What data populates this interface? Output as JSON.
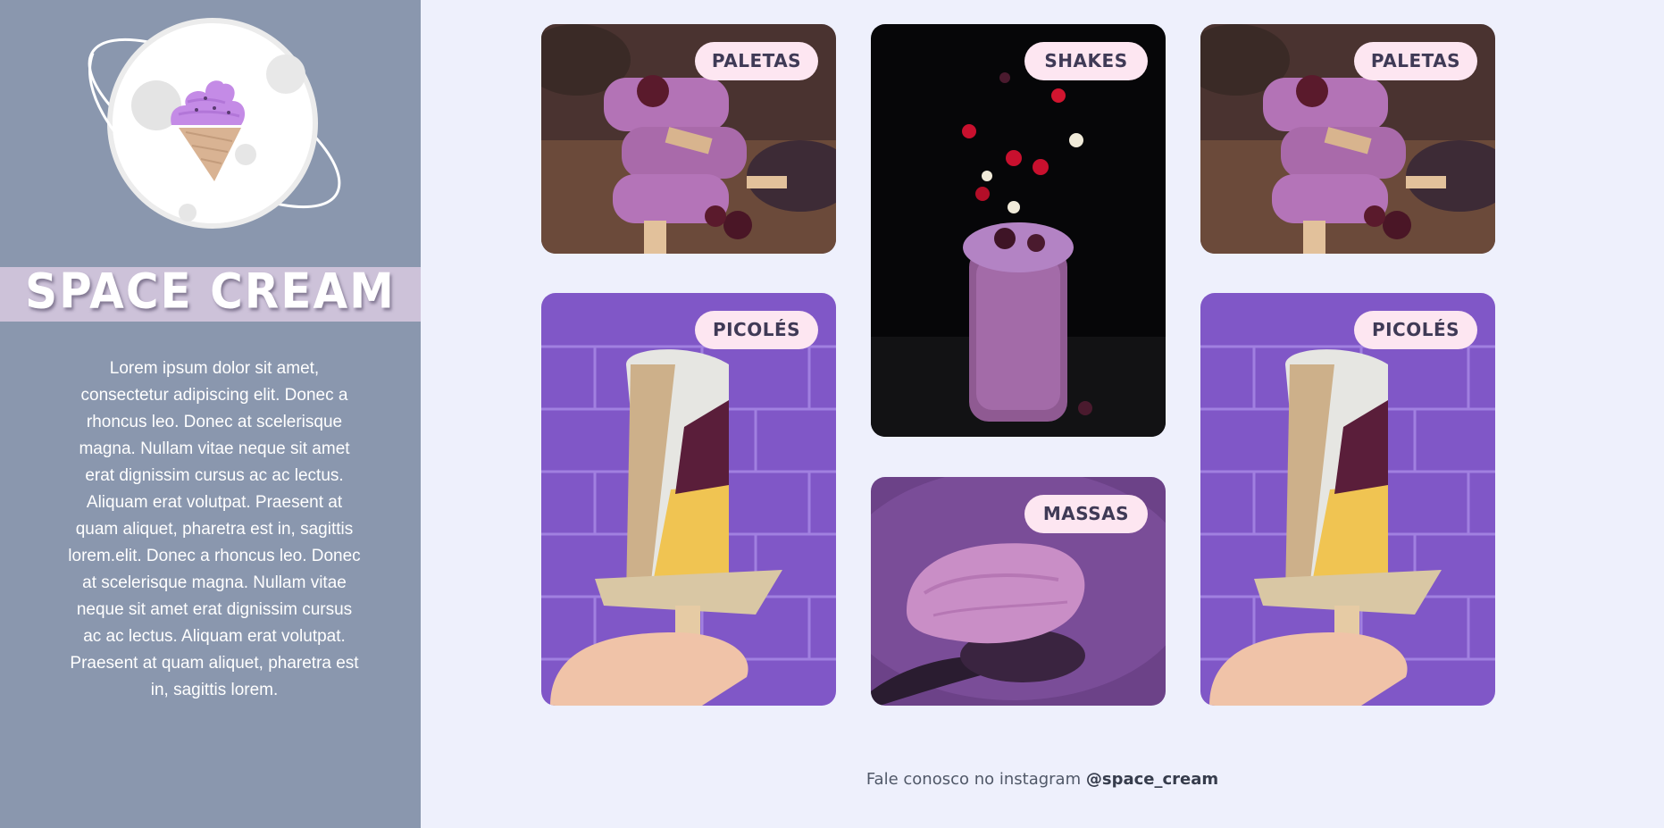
{
  "brand": {
    "name": "SPACE CREAM"
  },
  "about": {
    "text": "Lorem ipsum dolor sit amet, consectetur adipiscing elit. Donec a rhoncus leo. Donec at scelerisque magna. Nullam vitae neque sit amet erat dignissim cursus ac ac lectus. Aliquam erat volutpat. Praesent at quam aliquet, pharetra est in, sagittis lorem.elit. Donec a rhoncus leo. Donec at scelerisque magna. Nullam vitae neque sit amet erat dignissim cursus ac ac lectus. Aliquam erat volutpat. Praesent at quam aliquet, pharetra est in, sagittis lorem."
  },
  "gallery": {
    "cards": [
      {
        "label": "PALETAS",
        "photo": "stacked-popsicles-photo"
      },
      {
        "label": "SHAKES",
        "photo": "berry-shake-photo"
      },
      {
        "label": "PALETAS",
        "photo": "stacked-popsicles-photo"
      },
      {
        "label": "PICOLÉS",
        "photo": "dipped-popsicle-photo"
      },
      {
        "label": "MASSAS",
        "photo": "ice-cream-spoon-photo"
      },
      {
        "label": "PICOLÉS",
        "photo": "dipped-popsicle-photo"
      }
    ]
  },
  "footer": {
    "prefix": "Fale conosco no instagram",
    "handle": "@space_cream"
  },
  "colors": {
    "sidebar": "#8a97ae",
    "band": "#cdc2d9",
    "background": "#eef0fc",
    "pill": "#fde6f1",
    "pill_text": "#3f3a56"
  }
}
